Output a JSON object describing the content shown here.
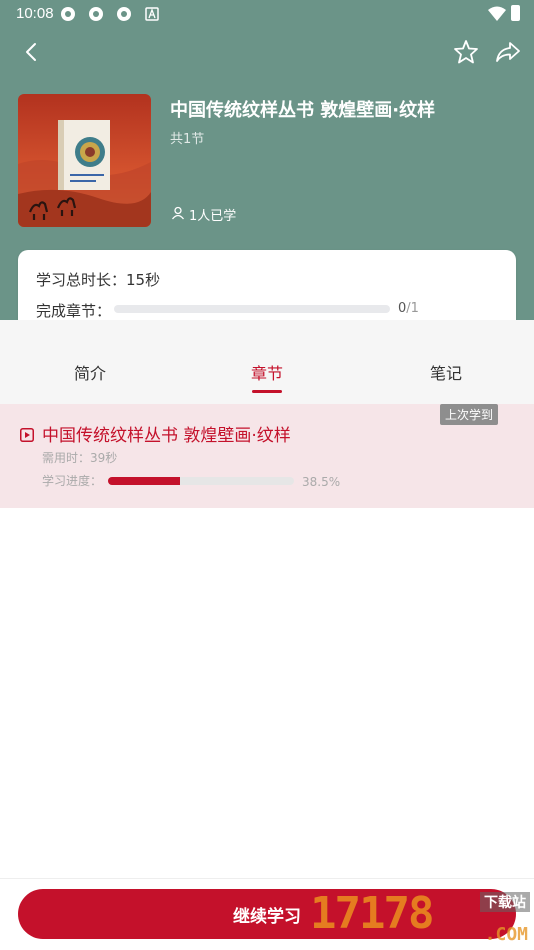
{
  "status_bar": {
    "time": "10:08"
  },
  "course": {
    "title": "中国传统纹样丛书 敦煌壁画·纹样",
    "sections": "共1节",
    "learners": "1人已学"
  },
  "stats": {
    "total_time": "学习总时长：15秒",
    "completed_label": "完成章节：",
    "completed_count": "0",
    "completed_total": "/1",
    "completed_fraction": 0
  },
  "tabs": [
    {
      "label": "简介",
      "active": false
    },
    {
      "label": "章节",
      "active": true
    },
    {
      "label": "笔记",
      "active": false
    }
  ],
  "chapter": {
    "badge": "上次学到",
    "title": "中国传统纹样丛书 敦煌壁画·纹样",
    "duration": "需用时：39秒",
    "progress_label": "学习进度：",
    "progress_percent": 38.5,
    "progress_text": "38.5%"
  },
  "bottom": {
    "continue_label": "继续学习"
  },
  "watermark": {
    "number": "17178",
    "tag": "下载站",
    "domain": ".COM"
  },
  "colors": {
    "header": "#6b9488",
    "accent": "#c4112b",
    "chapter_bg": "#f6e5e8"
  }
}
